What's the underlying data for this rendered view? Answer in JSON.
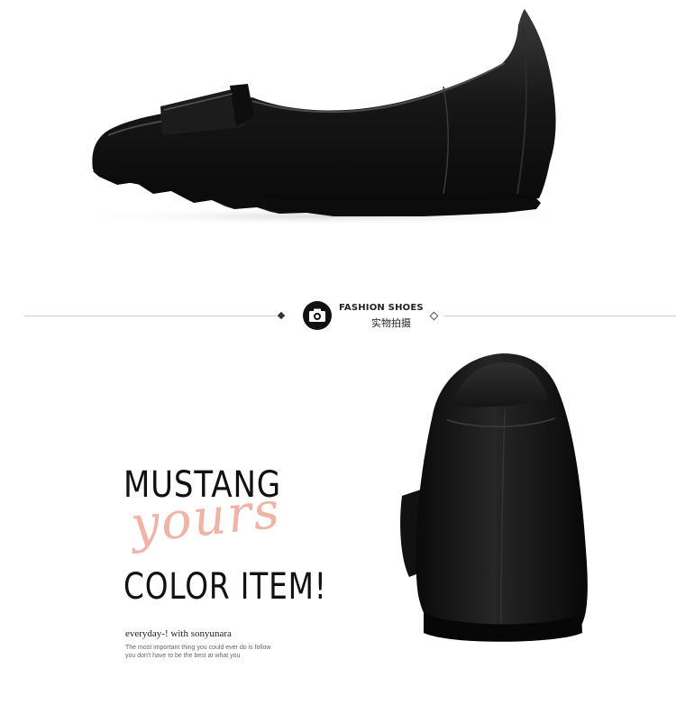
{
  "badge": {
    "icon": "camera-icon",
    "title": "FASHION SHOES",
    "subtitle": "实物拍摄"
  },
  "headline": {
    "line1": "MUSTANG",
    "script": "yours",
    "line2": "COLOR ITEM!"
  },
  "tagline": "everyday-! with sonyunara",
  "body_text": {
    "line1": "The most important thing you could ever do is follow",
    "line2": "you don't have to be the best at what you"
  },
  "colors": {
    "accent_script": "#f0b3a6",
    "shoe_black": "#151515",
    "divider": "#cfcfcf"
  }
}
